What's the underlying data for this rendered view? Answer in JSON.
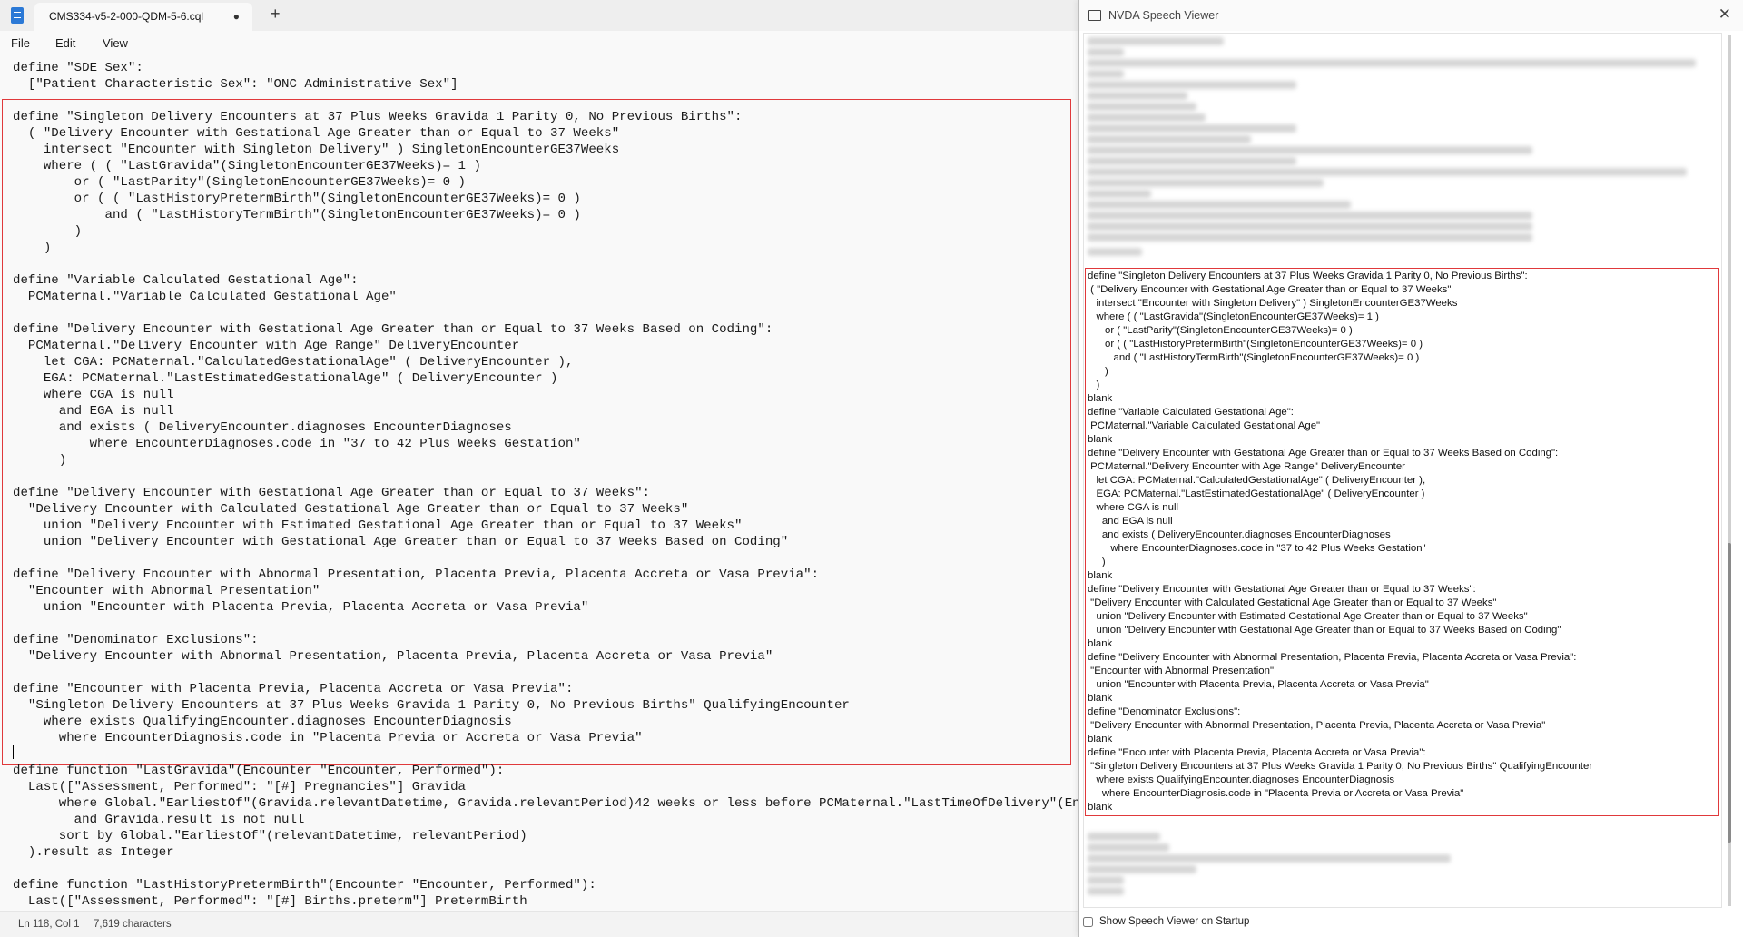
{
  "notepad": {
    "tab_title": "CMS334-v5-2-000-QDM-5-6.cql",
    "tab_modified": "●",
    "new_tab": "+",
    "menu": {
      "file": "File",
      "edit": "Edit",
      "view": "View"
    },
    "code_top": "define \"SDE Sex\":\n  [\"Patient Characteristic Sex\": \"ONC Administrative Sex\"]",
    "code_selected": "define \"Singleton Delivery Encounters at 37 Plus Weeks Gravida 1 Parity 0, No Previous Births\":\n  ( \"Delivery Encounter with Gestational Age Greater than or Equal to 37 Weeks\"\n    intersect \"Encounter with Singleton Delivery\" ) SingletonEncounterGE37Weeks\n    where ( ( \"LastGravida\"(SingletonEncounterGE37Weeks)= 1 )\n        or ( \"LastParity\"(SingletonEncounterGE37Weeks)= 0 )\n        or ( ( \"LastHistoryPretermBirth\"(SingletonEncounterGE37Weeks)= 0 )\n            and ( \"LastHistoryTermBirth\"(SingletonEncounterGE37Weeks)= 0 )\n        )\n    )\n\ndefine \"Variable Calculated Gestational Age\":\n  PCMaternal.\"Variable Calculated Gestational Age\"\n\ndefine \"Delivery Encounter with Gestational Age Greater than or Equal to 37 Weeks Based on Coding\":\n  PCMaternal.\"Delivery Encounter with Age Range\" DeliveryEncounter\n    let CGA: PCMaternal.\"CalculatedGestationalAge\" ( DeliveryEncounter ),\n    EGA: PCMaternal.\"LastEstimatedGestationalAge\" ( DeliveryEncounter )\n    where CGA is null\n      and EGA is null\n      and exists ( DeliveryEncounter.diagnoses EncounterDiagnoses\n          where EncounterDiagnoses.code in \"37 to 42 Plus Weeks Gestation\"\n      )\n\ndefine \"Delivery Encounter with Gestational Age Greater than or Equal to 37 Weeks\":\n  \"Delivery Encounter with Calculated Gestational Age Greater than or Equal to 37 Weeks\"\n    union \"Delivery Encounter with Estimated Gestational Age Greater than or Equal to 37 Weeks\"\n    union \"Delivery Encounter with Gestational Age Greater than or Equal to 37 Weeks Based on Coding\"\n\ndefine \"Delivery Encounter with Abnormal Presentation, Placenta Previa, Placenta Accreta or Vasa Previa\":\n  \"Encounter with Abnormal Presentation\"\n    union \"Encounter with Placenta Previa, Placenta Accreta or Vasa Previa\"\n\ndefine \"Denominator Exclusions\":\n  \"Delivery Encounter with Abnormal Presentation, Placenta Previa, Placenta Accreta or Vasa Previa\"\n\ndefine \"Encounter with Placenta Previa, Placenta Accreta or Vasa Previa\":\n  \"Singleton Delivery Encounters at 37 Plus Weeks Gravida 1 Parity 0, No Previous Births\" QualifyingEncounter\n    where exists QualifyingEncounter.diagnoses EncounterDiagnosis\n      where EncounterDiagnosis.code in \"Placenta Previa or Accreta or Vasa Previa\"",
    "code_bottom": "define function \"LastGravida\"(Encounter \"Encounter, Performed\"):\n  Last([\"Assessment, Performed\": \"[#] Pregnancies\"] Gravida\n      where Global.\"EarliestOf\"(Gravida.relevantDatetime, Gravida.relevantPeriod)42 weeks or less before PCMaternal.\"LastTimeOfDelivery\"(Encounter)\n        and Gravida.result is not null\n      sort by Global.\"EarliestOf\"(relevantDatetime, relevantPeriod)\n  ).result as Integer\n\ndefine function \"LastHistoryPretermBirth\"(Encounter \"Encounter, Performed\"):\n  Last([\"Assessment, Performed\": \"[#] Births.preterm\"] PretermBirth",
    "status": {
      "position": "Ln 118, Col 1",
      "chars": "7,619 characters"
    }
  },
  "nvda": {
    "title": "NVDA Speech Viewer",
    "close": "✕",
    "speech_text": "define \"Singleton Delivery Encounters at 37 Plus Weeks Gravida 1 Parity 0, No Previous Births\":\n ( \"Delivery Encounter with Gestational Age Greater than or Equal to 37 Weeks\"\n   intersect \"Encounter with Singleton Delivery\" ) SingletonEncounterGE37Weeks\n   where ( ( \"LastGravida\"(SingletonEncounterGE37Weeks)= 1 )\n      or ( \"LastParity\"(SingletonEncounterGE37Weeks)= 0 )\n      or ( ( \"LastHistoryPretermBirth\"(SingletonEncounterGE37Weeks)= 0 )\n         and ( \"LastHistoryTermBirth\"(SingletonEncounterGE37Weeks)= 0 )\n      )\n   )\nblank\ndefine \"Variable Calculated Gestational Age\":\n PCMaternal.\"Variable Calculated Gestational Age\"\nblank\ndefine \"Delivery Encounter with Gestational Age Greater than or Equal to 37 Weeks Based on Coding\":\n PCMaternal.\"Delivery Encounter with Age Range\" DeliveryEncounter\n   let CGA: PCMaternal.\"CalculatedGestationalAge\" ( DeliveryEncounter ),\n   EGA: PCMaternal.\"LastEstimatedGestationalAge\" ( DeliveryEncounter )\n   where CGA is null\n     and EGA is null\n     and exists ( DeliveryEncounter.diagnoses EncounterDiagnoses\n        where EncounterDiagnoses.code in \"37 to 42 Plus Weeks Gestation\"\n     )\nblank\ndefine \"Delivery Encounter with Gestational Age Greater than or Equal to 37 Weeks\":\n \"Delivery Encounter with Calculated Gestational Age Greater than or Equal to 37 Weeks\"\n   union \"Delivery Encounter with Estimated Gestational Age Greater than or Equal to 37 Weeks\"\n   union \"Delivery Encounter with Gestational Age Greater than or Equal to 37 Weeks Based on Coding\"\nblank\ndefine \"Delivery Encounter with Abnormal Presentation, Placenta Previa, Placenta Accreta or Vasa Previa\":\n \"Encounter with Abnormal Presentation\"\n   union \"Encounter with Placenta Previa, Placenta Accreta or Vasa Previa\"\nblank\ndefine \"Denominator Exclusions\":\n \"Delivery Encounter with Abnormal Presentation, Placenta Previa, Placenta Accreta or Vasa Previa\"\nblank\ndefine \"Encounter with Placenta Previa, Placenta Accreta or Vasa Previa\":\n \"Singleton Delivery Encounters at 37 Plus Weeks Gravida 1 Parity 0, No Previous Births\" QualifyingEncounter\n   where exists QualifyingEncounter.diagnoses EncounterDiagnosis\n     where EncounterDiagnosis.code in \"Placenta Previa or Accreta or Vasa Previa\"\nblank",
    "show_on_startup": "Show Speech Viewer on Startup"
  },
  "colors": {
    "highlight": "#e0393b",
    "accent": "#2b79d6"
  }
}
